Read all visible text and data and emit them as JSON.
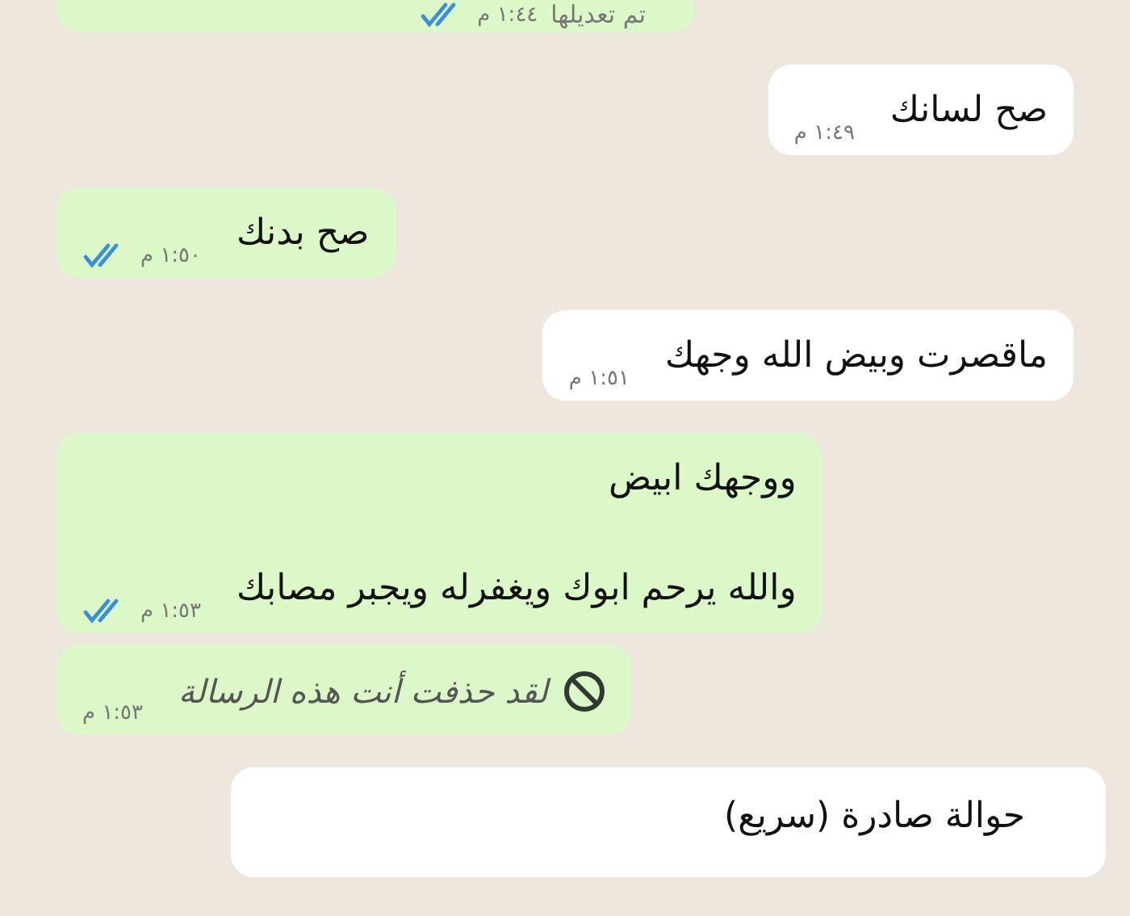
{
  "messages": [
    {
      "outgoing": true,
      "kind": "edited",
      "edited_label": "تم تعديلها",
      "time": "١:٤٤ م",
      "read": true
    },
    {
      "outgoing": false,
      "kind": "text",
      "text": "صح لسانك",
      "time": "١:٤٩ م"
    },
    {
      "outgoing": true,
      "kind": "text",
      "text": "صح بدنك",
      "time": "١:٥٠ م",
      "read": true
    },
    {
      "outgoing": false,
      "kind": "text",
      "text": "ماقصرت وبيض الله وجهك",
      "time": "١:٥١ م"
    },
    {
      "outgoing": true,
      "kind": "text",
      "text": "ووجهك ابيض\n\nوالله يرحم ابوك ويغفرله ويجبر مصابك",
      "time": "١:٥٣ م",
      "read": true
    },
    {
      "outgoing": true,
      "kind": "deleted",
      "text": "لقد حذفت أنت هذه الرسالة",
      "time": "١:٥٣ م"
    },
    {
      "outgoing": false,
      "kind": "text",
      "text": "حوالة صادرة (سريع)"
    }
  ]
}
